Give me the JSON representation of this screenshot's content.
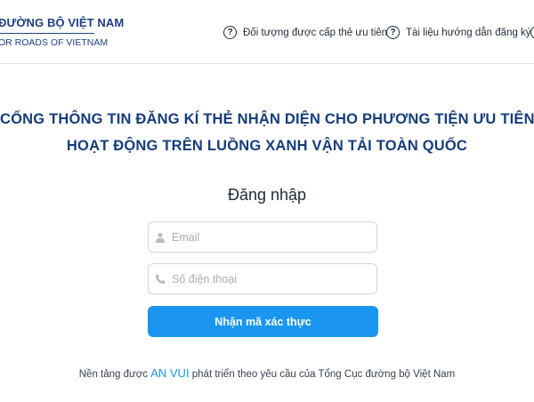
{
  "header": {
    "brand_line1": "ĐƯỜNG BỘ VIỆT NAM",
    "brand_line2": "OR ROADS OF VIETNAM",
    "nav": [
      {
        "label": "Đối tượng được cấp thẻ ưu tiên",
        "icon": "question-circle-icon"
      },
      {
        "label": "Tài liệu hướng dẫn đăng ký",
        "icon": "question-circle-icon"
      }
    ]
  },
  "main": {
    "title_line1": "CỔNG THÔNG TIN ĐĂNG KÍ THẺ NHẬN DIỆN CHO PHƯƠNG TIỆN ƯU TIÊN",
    "title_line2": "HOẠT ĐỘNG TRÊN LUỒNG XANH VẬN TẢI TOÀN QUỐC",
    "login_heading": "Đăng nhập",
    "email": {
      "placeholder": "Email",
      "value": "",
      "icon": "user-icon"
    },
    "phone": {
      "placeholder": "Số điện thoại",
      "value": "",
      "icon": "phone-icon"
    },
    "submit_label": "Nhận mã xác thực"
  },
  "footer": {
    "prefix": "Nền tảng được",
    "brand": "AN VUI",
    "suffix": "phát triển theo yêu cầu của Tổng Cục đường bộ Việt Nam"
  },
  "colors": {
    "primary": "#1a96f1",
    "title": "#163d7a",
    "brand": "#1c3f86"
  }
}
